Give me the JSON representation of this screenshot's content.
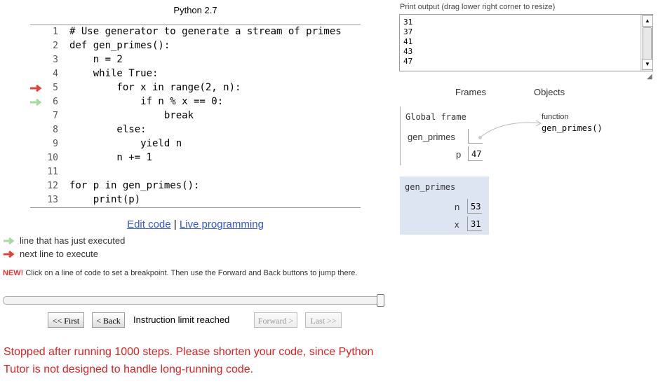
{
  "code_pane": {
    "language": "Python 2.7",
    "lines": [
      {
        "num": "1",
        "text": "# Use generator to generate a stream of primes",
        "arrow": ""
      },
      {
        "num": "2",
        "text": "def gen_primes():",
        "arrow": ""
      },
      {
        "num": "3",
        "text": "    n = 2",
        "arrow": ""
      },
      {
        "num": "4",
        "text": "    while True:",
        "arrow": ""
      },
      {
        "num": "5",
        "text": "        for x in range(2, n):",
        "arrow": "next"
      },
      {
        "num": "6",
        "text": "            if n % x == 0:",
        "arrow": "executed"
      },
      {
        "num": "7",
        "text": "                break",
        "arrow": ""
      },
      {
        "num": "8",
        "text": "        else:",
        "arrow": ""
      },
      {
        "num": "9",
        "text": "            yield n",
        "arrow": ""
      },
      {
        "num": "10",
        "text": "        n += 1",
        "arrow": ""
      },
      {
        "num": "11",
        "text": "",
        "arrow": ""
      },
      {
        "num": "12",
        "text": "for p in gen_primes():",
        "arrow": ""
      },
      {
        "num": "13",
        "text": "    print(p)",
        "arrow": ""
      }
    ]
  },
  "links": {
    "edit_code": "Edit code",
    "separator": "|",
    "live_programming": "Live programming"
  },
  "legend": {
    "executed": "line that has just executed",
    "next": "next line to execute",
    "executed_color": "#a6dba0",
    "next_color": "#e2403b"
  },
  "breakpoint_note": {
    "new_label": "NEW!",
    "text": " Click on a line of code to set a breakpoint. Then use the Forward and Back buttons to jump there."
  },
  "navigation": {
    "first": "<< First",
    "back": "< Back",
    "status": "Instruction limit reached",
    "forward": "Forward >",
    "last": "Last >>"
  },
  "error_message": "Stopped after running 1000 steps. Please shorten your code, since Python Tutor is not designed to handle long-running code.",
  "print_output": {
    "label": "Print output (drag lower right corner to resize)",
    "lines": [
      "31",
      "37",
      "41",
      "43",
      "47"
    ]
  },
  "visualization": {
    "frames_header": "Frames",
    "objects_header": "Objects",
    "global_frame": {
      "title": "Global frame",
      "vars": [
        {
          "name": "gen_primes",
          "value": ""
        },
        {
          "name": "p",
          "value": "47"
        }
      ]
    },
    "stack_frame": {
      "title": "gen_primes",
      "vars": [
        {
          "name": "n",
          "value": "53"
        },
        {
          "name": "x",
          "value": "31"
        }
      ]
    },
    "function_object": {
      "type_label": "function",
      "name": "gen_primes()"
    }
  }
}
